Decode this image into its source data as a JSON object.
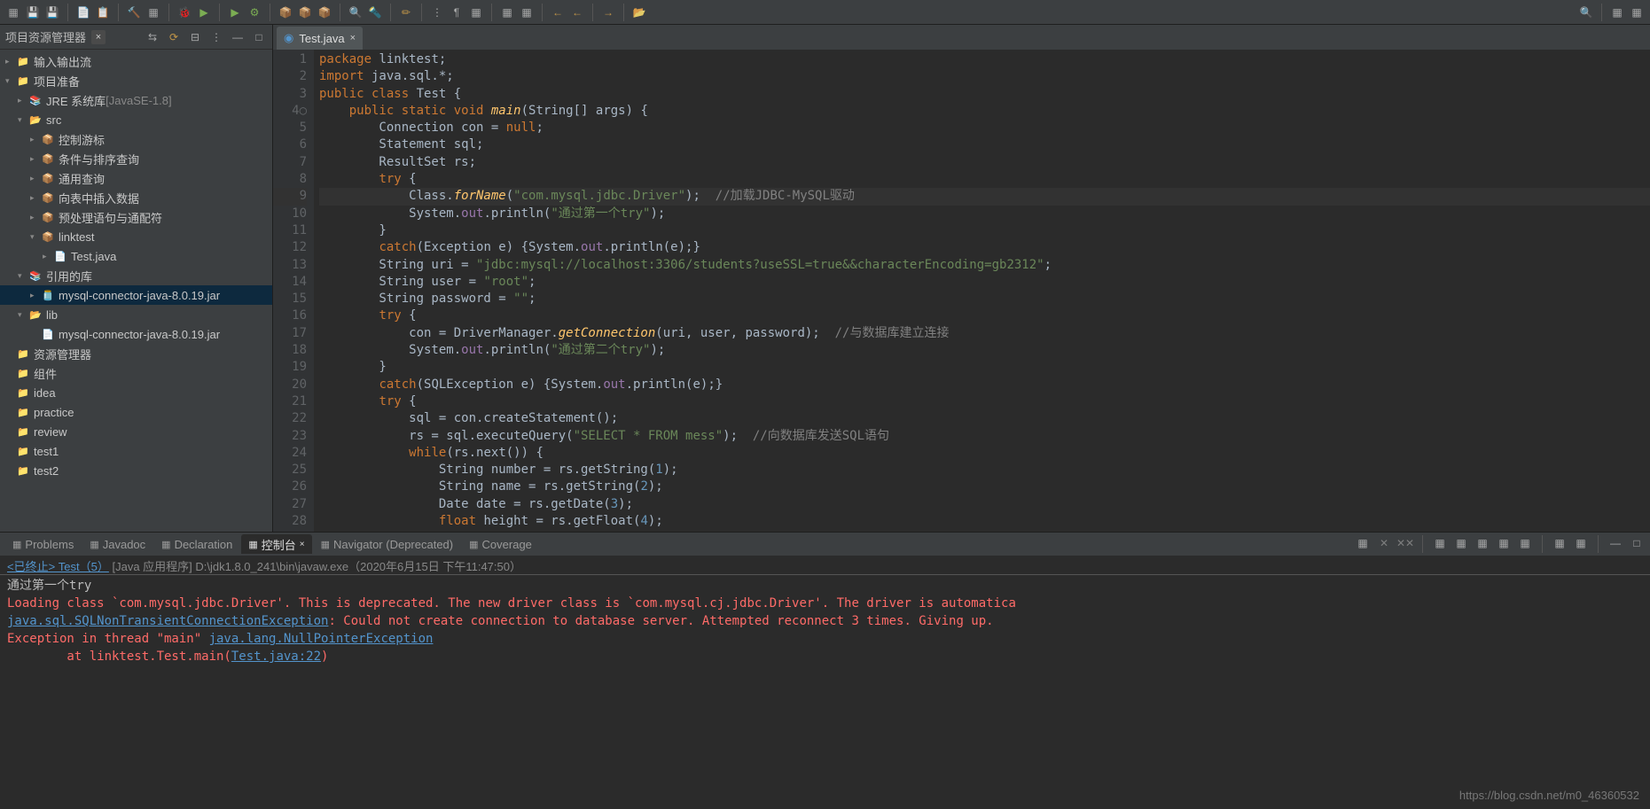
{
  "sidebar": {
    "title": "项目资源管理器",
    "items": [
      {
        "label": "输入输出流",
        "indent": 0,
        "arrow": "▸",
        "icon": "📁"
      },
      {
        "label": "项目准备",
        "indent": 0,
        "arrow": "▾",
        "icon": "📁"
      },
      {
        "label": "JRE 系统库 ",
        "dim": "[JavaSE-1.8]",
        "indent": 1,
        "arrow": "▸",
        "icon": "📚"
      },
      {
        "label": "src",
        "indent": 1,
        "arrow": "▾",
        "icon": "📂"
      },
      {
        "label": "控制游标",
        "indent": 2,
        "arrow": "▸",
        "icon": "📦"
      },
      {
        "label": "条件与排序查询",
        "indent": 2,
        "arrow": "▸",
        "icon": "📦"
      },
      {
        "label": "通用查询",
        "indent": 2,
        "arrow": "▸",
        "icon": "📦"
      },
      {
        "label": "向表中插入数据",
        "indent": 2,
        "arrow": "▸",
        "icon": "📦"
      },
      {
        "label": "预处理语句与通配符",
        "indent": 2,
        "arrow": "▸",
        "icon": "📦"
      },
      {
        "label": "linktest",
        "indent": 2,
        "arrow": "▾",
        "icon": "📦"
      },
      {
        "label": "Test.java",
        "indent": 3,
        "arrow": "▸",
        "icon": "📄"
      },
      {
        "label": "引用的库",
        "indent": 1,
        "arrow": "▾",
        "icon": "📚"
      },
      {
        "label": "mysql-connector-java-8.0.19.jar",
        "indent": 2,
        "arrow": "▸",
        "icon": "🫙",
        "selected": true
      },
      {
        "label": "lib",
        "indent": 1,
        "arrow": "▾",
        "icon": "📂"
      },
      {
        "label": "mysql-connector-java-8.0.19.jar",
        "indent": 2,
        "arrow": "",
        "icon": "📄"
      },
      {
        "label": "资源管理器",
        "indent": 0,
        "arrow": "",
        "icon": "📁"
      },
      {
        "label": "组件",
        "indent": 0,
        "arrow": "",
        "icon": "📁"
      },
      {
        "label": "idea",
        "indent": 0,
        "arrow": "",
        "icon": "📁"
      },
      {
        "label": "practice",
        "indent": 0,
        "arrow": "",
        "icon": "📁"
      },
      {
        "label": "review",
        "indent": 0,
        "arrow": "",
        "icon": "📁"
      },
      {
        "label": "test1",
        "indent": 0,
        "arrow": "",
        "icon": "📁"
      },
      {
        "label": "test2",
        "indent": 0,
        "arrow": "",
        "icon": "📁"
      }
    ]
  },
  "editor": {
    "tab": "Test.java",
    "lines": [
      {
        "n": 1,
        "html": "<span class='kw'>package</span> linktest;"
      },
      {
        "n": 2,
        "html": "<span class='kw'>import</span> java.sql.*;"
      },
      {
        "n": 3,
        "html": "<span class='kw'>public class</span> <span class='cls'>Test</span> {"
      },
      {
        "n": 4,
        "html": "    <span class='kw'>public static void</span> <span class='mth'>main</span>(<span class='cls'>String</span>[] args) {",
        "mark": "○"
      },
      {
        "n": 5,
        "html": "        Connection con = <span class='kw'>null</span>;"
      },
      {
        "n": 6,
        "html": "        Statement sql;"
      },
      {
        "n": 7,
        "html": "        ResultSet rs;"
      },
      {
        "n": 8,
        "html": "        <span class='kw'>try</span> {"
      },
      {
        "n": 9,
        "html": "            Class.<span class='mth'>forName</span>(<span class='str'>\"com.mysql.jdbc.Driver\"</span>);  <span class='com'>//加载JDBC-MySQL驱动</span>",
        "hl": true
      },
      {
        "n": 10,
        "html": "            System.<span class='fld'>out</span>.println(<span class='str'>\"通过第一个try\"</span>);"
      },
      {
        "n": 11,
        "html": "        }"
      },
      {
        "n": 12,
        "html": "        <span class='kw'>catch</span>(Exception e) {System.<span class='fld'>out</span>.println(e);}"
      },
      {
        "n": 13,
        "html": "        String uri = <span class='str'>\"jdbc:mysql://localhost:3306/students?useSSL=true&&characterEncoding=gb2312\"</span>;"
      },
      {
        "n": 14,
        "html": "        String user = <span class='str'>\"root\"</span>;"
      },
      {
        "n": 15,
        "html": "        String password = <span class='str'>\"\"</span>;"
      },
      {
        "n": 16,
        "html": "        <span class='kw'>try</span> {"
      },
      {
        "n": 17,
        "html": "            con = DriverManager.<span class='mth'>getConnection</span>(uri, user, password);  <span class='com'>//与数据库建立连接</span>"
      },
      {
        "n": 18,
        "html": "            System.<span class='fld'>out</span>.println(<span class='str'>\"通过第二个try\"</span>);"
      },
      {
        "n": 19,
        "html": "        }"
      },
      {
        "n": 20,
        "html": "        <span class='kw'>catch</span>(SQLException e) {System.<span class='fld'>out</span>.println(e);}"
      },
      {
        "n": 21,
        "html": "        <span class='kw'>try</span> {"
      },
      {
        "n": 22,
        "html": "            sql = con.createStatement();"
      },
      {
        "n": 23,
        "html": "            rs = sql.executeQuery(<span class='str'>\"SELECT * FROM mess\"</span>);  <span class='com'>//向数据库发送SQL语句</span>"
      },
      {
        "n": 24,
        "html": "            <span class='kw'>while</span>(rs.next()) {"
      },
      {
        "n": 25,
        "html": "                String number = rs.getString(<span class='num'>1</span>);"
      },
      {
        "n": 26,
        "html": "                String name = rs.getString(<span class='num'>2</span>);"
      },
      {
        "n": 27,
        "html": "                Date date = rs.getDate(<span class='num'>3</span>);"
      },
      {
        "n": 28,
        "html": "                <span class='kw'>float</span> height = rs.getFloat(<span class='num'>4</span>);"
      }
    ]
  },
  "bottom": {
    "tabs": [
      "Problems",
      "Javadoc",
      "Declaration",
      "控制台",
      "Navigator (Deprecated)",
      "Coverage"
    ],
    "active_tab": 3,
    "header_prefix": "<已终止> Test（5）",
    "header_rest": "  [Java 应用程序] D:\\jdk1.8.0_241\\bin\\javaw.exe（2020年6月15日 下午11:47:50）",
    "console": [
      {
        "cls": "con-out",
        "text": "通过第一个try"
      },
      {
        "cls": "con-err",
        "text": "Loading class `com.mysql.jdbc.Driver'. This is deprecated. The new driver class is `com.mysql.cj.jdbc.Driver'. The driver is automatica"
      },
      {
        "cls": "con-err",
        "html": "<span class='con-lnk'>java.sql.SQLNonTransientConnectionException</span>: Could not create connection to database server. Attempted reconnect 3 times. Giving up."
      },
      {
        "cls": "con-err",
        "html": "Exception in thread \"main\" <span class='con-lnk'>java.lang.NullPointerException</span>"
      },
      {
        "cls": "con-err",
        "html": "        at linktest.Test.main(<span class='con-lnk'>Test.java:22</span>)"
      }
    ]
  },
  "watermark": "https://blog.csdn.net/m0_46360532"
}
